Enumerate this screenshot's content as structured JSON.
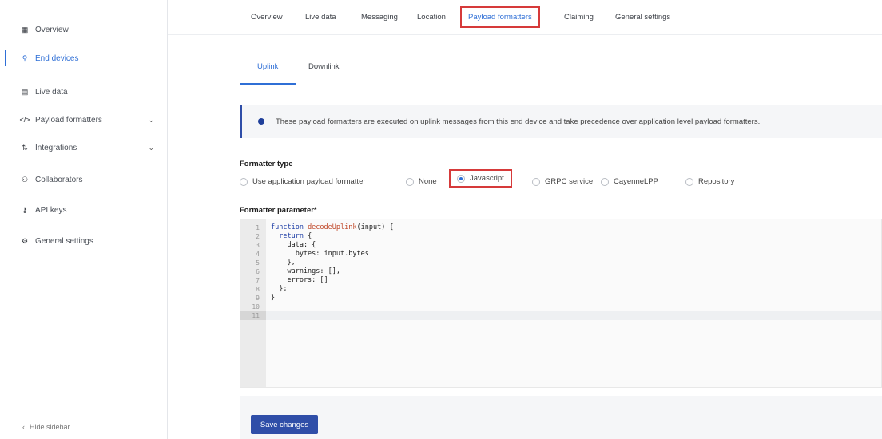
{
  "sidebar": {
    "items": [
      {
        "label": "Overview",
        "icon": "grid-icon",
        "glyph": "▦",
        "active": false
      },
      {
        "label": "End devices",
        "icon": "user-icon",
        "glyph": "⚲",
        "active": true
      },
      {
        "label": "Live data",
        "icon": "list-icon",
        "glyph": "▤",
        "active": false
      },
      {
        "label": "Payload formatters",
        "icon": "code-icon",
        "glyph": "</>",
        "active": false,
        "expandable": true
      },
      {
        "label": "Integrations",
        "icon": "integrations-icon",
        "glyph": "⇅",
        "active": false,
        "expandable": true
      },
      {
        "label": "Collaborators",
        "icon": "people-icon",
        "glyph": "⚇",
        "active": false
      },
      {
        "label": "API keys",
        "icon": "key-icon",
        "glyph": "⚷",
        "active": false
      },
      {
        "label": "General settings",
        "icon": "gear-icon",
        "glyph": "⚙",
        "active": false
      }
    ],
    "hide_label": "Hide sidebar",
    "hide_glyph": "‹"
  },
  "top_tabs": [
    {
      "label": "Overview",
      "active": false
    },
    {
      "label": "Live data",
      "active": false
    },
    {
      "label": "Messaging",
      "active": false
    },
    {
      "label": "Location",
      "active": false
    },
    {
      "label": "Payload formatters",
      "active": true,
      "highlighted": true
    },
    {
      "label": "Claiming",
      "active": false
    },
    {
      "label": "General settings",
      "active": false
    }
  ],
  "sub_tabs": [
    {
      "label": "Uplink",
      "active": true
    },
    {
      "label": "Downlink",
      "active": false
    }
  ],
  "notice": {
    "text": "These payload formatters are executed on uplink messages from this end device and take precedence over application level payload formatters."
  },
  "formatter_type": {
    "label": "Formatter type",
    "options": [
      {
        "label": "Use application payload formatter",
        "selected": false
      },
      {
        "label": "None",
        "selected": false
      },
      {
        "label": "Javascript",
        "selected": true,
        "highlighted": true
      },
      {
        "label": "GRPC service",
        "selected": false
      },
      {
        "label": "CayenneLPP",
        "selected": false
      },
      {
        "label": "Repository",
        "selected": false
      }
    ]
  },
  "formatter_parameter": {
    "label": "Formatter parameter*",
    "line_numbers": [
      "1",
      "2",
      "3",
      "4",
      "5",
      "6",
      "7",
      "8",
      "9",
      "10",
      "11"
    ],
    "lines": [
      {
        "kw": "function ",
        "fn": "decodeUplink",
        "rest": "(input) {"
      },
      {
        "kw": "  return ",
        "fn": "",
        "rest": "{"
      },
      {
        "kw": "",
        "fn": "",
        "rest": "    data: {"
      },
      {
        "kw": "",
        "fn": "",
        "rest": "      bytes: input.bytes"
      },
      {
        "kw": "",
        "fn": "",
        "rest": "    },"
      },
      {
        "kw": "",
        "fn": "",
        "rest": "    warnings: [],"
      },
      {
        "kw": "",
        "fn": "",
        "rest": "    errors: []"
      },
      {
        "kw": "",
        "fn": "",
        "rest": "  };"
      },
      {
        "kw": "",
        "fn": "",
        "rest": "}"
      }
    ]
  },
  "save_button": {
    "label": "Save changes"
  },
  "colors": {
    "accent": "#2f6fd6",
    "primary_button": "#2f4ea8",
    "highlight": "#d63a3a"
  }
}
